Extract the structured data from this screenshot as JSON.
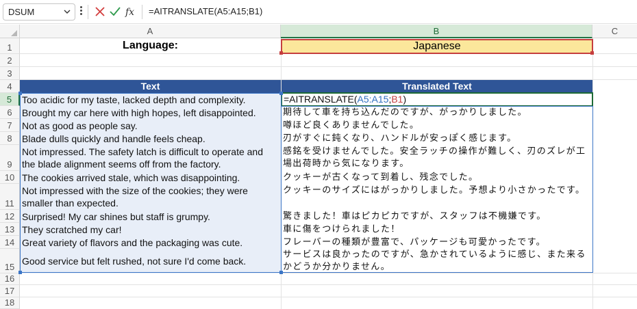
{
  "formula_bar": {
    "name_box": "DSUM",
    "formula": "=AITRANSLATE(A5:A15;B1)",
    "cancel_icon": "x-icon",
    "enter_icon": "check-icon",
    "fx_label": "fx"
  },
  "columns": [
    "A",
    "B",
    "C"
  ],
  "rows": [
    "1",
    "2",
    "3",
    "4",
    "5",
    "6",
    "7",
    "8",
    "9",
    "10",
    "11",
    "12",
    "13",
    "14",
    "15",
    "16",
    "17",
    "18"
  ],
  "sheet": {
    "language_label": "Language:",
    "language_value": "Japanese",
    "header_text": "Text",
    "header_translated": "Translated Text",
    "active_formula": {
      "prefix": "=AITRANSLATE(",
      "ref_a": "A5:A15",
      "sep": ";",
      "ref_b": "B1",
      "suffix": ")"
    },
    "texts": [
      "Too acidic for my taste, lacked depth and complexity.",
      "Brought my car here with high hopes, left disappointed.",
      "Not as good as people say.",
      "Blade dulls quickly and handle feels cheap.",
      "Not impressed. The safety latch is difficult to operate and the blade alignment seems off from the factory.",
      "The cookies arrived stale, which was disappointing.",
      "Not impressed with the size of the cookies; they were smaller than expected.",
      "Surprised! My car shines but staff is grumpy.",
      "They scratched my car!",
      "Great variety of flavors and the packaging was cute.",
      "Good service but felt rushed, not sure I'd come back."
    ],
    "translations": [
      "期待して車を持ち込んだのですが、がっかりしました。",
      "噂ほど良くありませんでした。",
      "刃がすぐに鈍くなり、ハンドルが安っぽく感じます。",
      "感銘を受けませんでした。安全ラッチの操作が難しく、刃のズレが工場出荷時から気になります。",
      "クッキーが古くなって到着し、残念でした。",
      "クッキーのサイズにはがっかりしました。予想より小さかったです。",
      "驚きました！車はピカピカですが、スタッフは不機嫌です。",
      "車に傷をつけられました！",
      "フレーバーの種類が豊富で、パッケージも可愛かったです。",
      "サービスは良かったのですが、急かされているように感じ、また来るかどうか分かりません。"
    ]
  },
  "colors": {
    "header_fill": "#2f5597",
    "column_a_fill": "#e8eef8",
    "language_fill": "#fbe79b",
    "language_border": "#c53e3e",
    "active_border": "#1e6b36",
    "ref_a_color": "#2f6fbf",
    "ref_b_color": "#c53e3e"
  }
}
